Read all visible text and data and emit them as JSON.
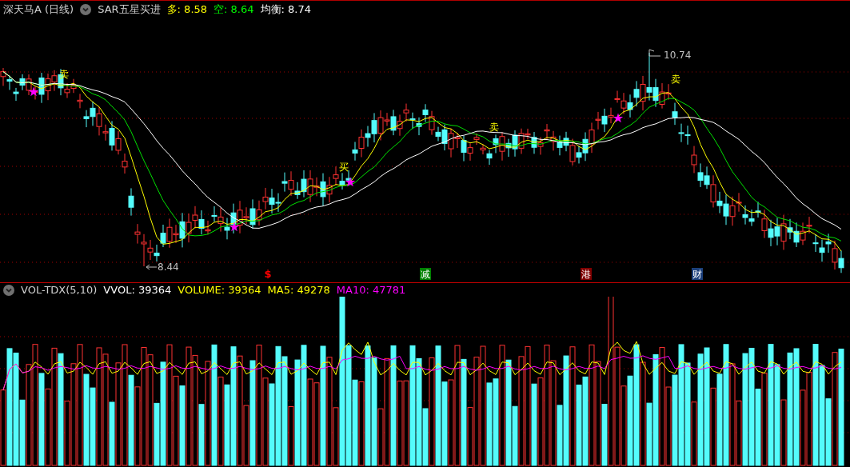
{
  "price_panel": {
    "title": "深天马A (日线)",
    "indicator": "SAR五星买进",
    "readings": [
      {
        "text": "多: 8.58",
        "color": "#ffff00"
      },
      {
        "text": "空: 8.64",
        "color": "#00ff00"
      },
      {
        "text": "均衡: 8.74",
        "color": "#ffffff"
      }
    ],
    "high_label": "10.74",
    "low_label": "8.44",
    "signals": [
      {
        "kind": "sell",
        "text": "卖"
      },
      {
        "kind": "buy",
        "text": "买"
      },
      {
        "kind": "sell",
        "text": "卖"
      },
      {
        "kind": "sell",
        "text": "卖"
      }
    ],
    "news_tags": [
      {
        "kind": "plain",
        "text": "$",
        "color": "#ff0000"
      },
      {
        "kind": "boxed",
        "text": "减",
        "color": "#008000"
      },
      {
        "kind": "boxed",
        "text": "港",
        "color": "#800000"
      },
      {
        "kind": "boxed",
        "text": "财",
        "color": "#1c3f7a"
      }
    ]
  },
  "volume_panel": {
    "indicator": "VOL-TDX(5,10)",
    "readings": [
      {
        "text": "VVOL: 39364",
        "color": "#ffffff"
      },
      {
        "text": "VOLUME: 39364",
        "color": "#ffff00"
      },
      {
        "text": "MA5: 49278",
        "color": "#ffff00"
      },
      {
        "text": "MA10: 47781",
        "color": "#ff00ff"
      }
    ]
  }
}
